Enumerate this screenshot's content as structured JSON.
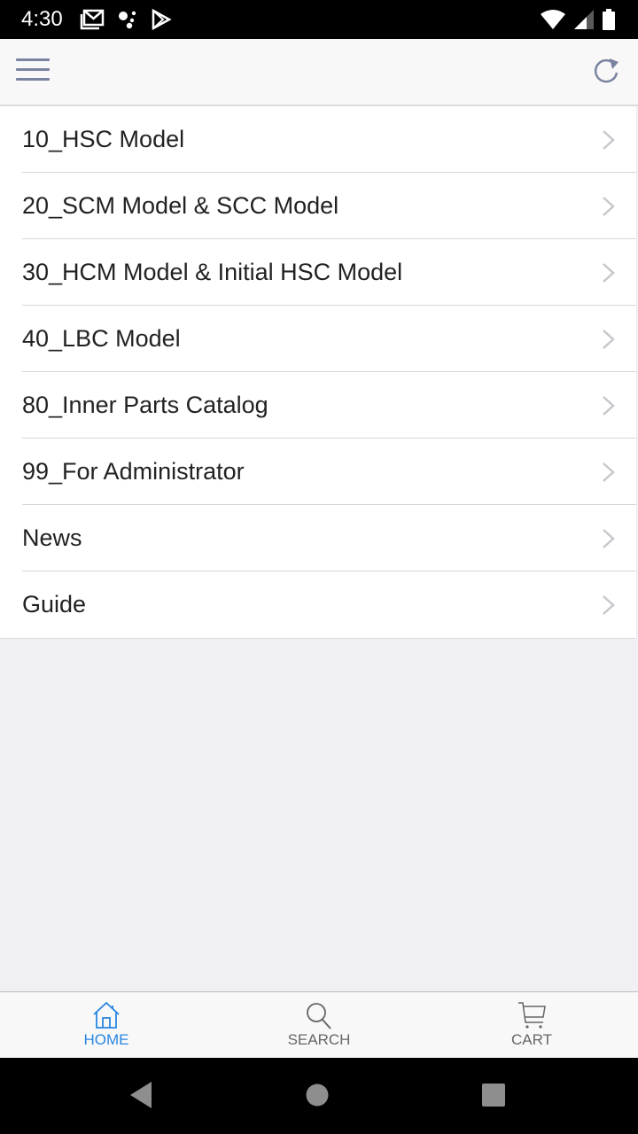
{
  "status_bar": {
    "time": "4:30",
    "left_icons": [
      "gmail-icon",
      "assistant-dots-icon",
      "play-store-icon"
    ],
    "right_icons": [
      "wifi-icon",
      "cell-signal-icon",
      "battery-icon"
    ]
  },
  "app_bar": {
    "menu_icon": "hamburger-menu-icon",
    "refresh_icon": "refresh-icon"
  },
  "menu_list": {
    "items": [
      {
        "label": "10_HSC Model"
      },
      {
        "label": "20_SCM Model & SCC Model"
      },
      {
        "label": "30_HCM Model & Initial HSC Model"
      },
      {
        "label": "40_LBC Model"
      },
      {
        "label": "80_Inner Parts Catalog"
      },
      {
        "label": "99_For Administrator"
      },
      {
        "label": "News"
      },
      {
        "label": "Guide"
      }
    ]
  },
  "bottom_nav": {
    "items": [
      {
        "label": "HOME",
        "icon": "home-icon",
        "active": true
      },
      {
        "label": "SEARCH",
        "icon": "search-icon",
        "active": false
      },
      {
        "label": "CART",
        "icon": "cart-icon",
        "active": false
      }
    ]
  },
  "colors": {
    "accent": "#2a86e0",
    "inactive": "#666666",
    "background": "#efeff4"
  }
}
